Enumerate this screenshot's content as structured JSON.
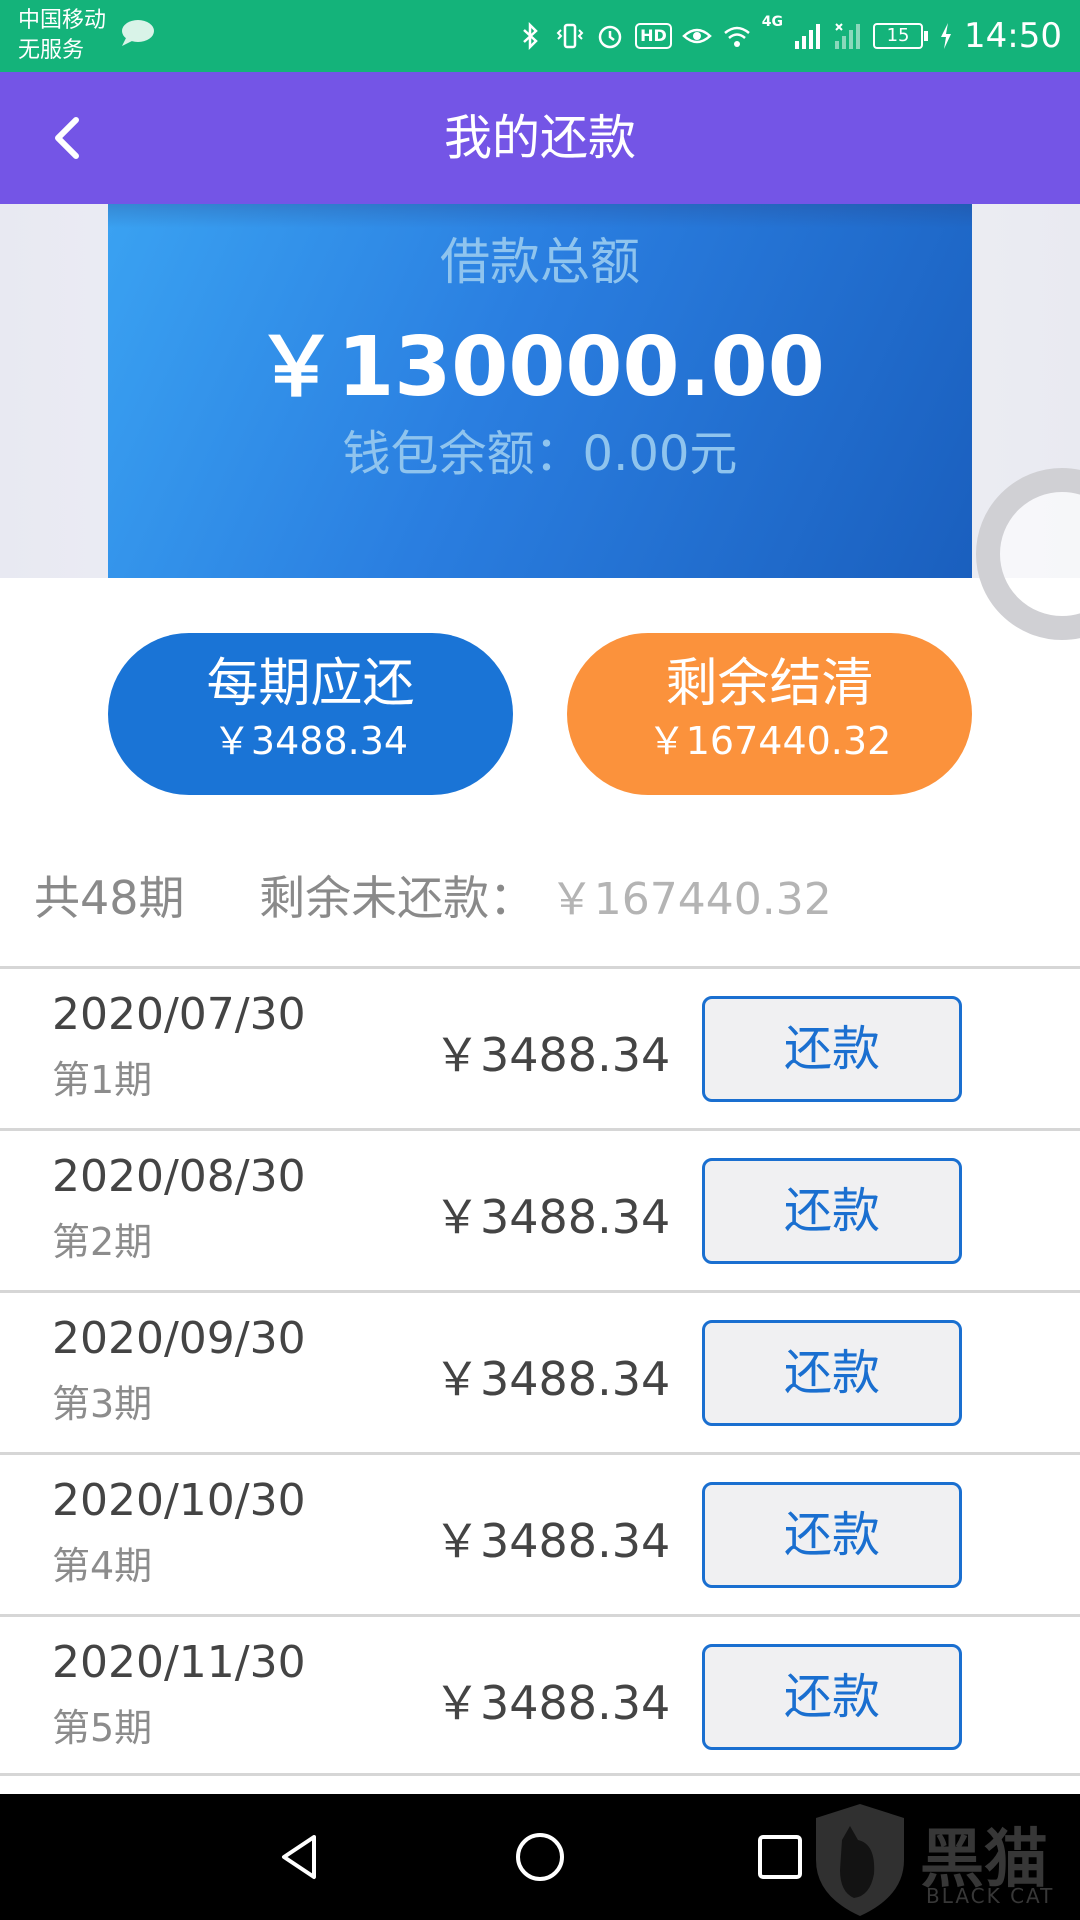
{
  "status_bar": {
    "carrier": "中国移动",
    "service": "无服务",
    "hd": "HD",
    "network": "4G",
    "battery": "15",
    "time": "14:50"
  },
  "header": {
    "title": "我的还款"
  },
  "loan_card": {
    "label": "借款总额",
    "amount": "￥130000.00",
    "wallet": "钱包余额：0.00元"
  },
  "summary": {
    "per_period_title": "每期应还",
    "per_period_value": "￥3488.34",
    "payoff_title": "剩余结清",
    "payoff_value": "￥167440.32"
  },
  "totals": {
    "periods": "共48期",
    "remaining_label": "剩余未还款：",
    "remaining_value": "￥167440.32"
  },
  "rows": [
    {
      "date": "2020/07/30",
      "period": "第1期",
      "amount": "￥3488.34",
      "button": "还款"
    },
    {
      "date": "2020/08/30",
      "period": "第2期",
      "amount": "￥3488.34",
      "button": "还款"
    },
    {
      "date": "2020/09/30",
      "period": "第3期",
      "amount": "￥3488.34",
      "button": "还款"
    },
    {
      "date": "2020/10/30",
      "period": "第4期",
      "amount": "￥3488.34",
      "button": "还款"
    },
    {
      "date": "2020/11/30",
      "period": "第5期",
      "amount": "￥3488.34",
      "button": "还款"
    }
  ],
  "watermark": {
    "text": "黑猫",
    "sub": "BLACK CAT"
  },
  "colors": {
    "status_bar": "#14b37a",
    "header": "#7455e6",
    "card_blue": "#2a7ee0",
    "pill_blue": "#1a74d6",
    "pill_orange": "#fb923c",
    "button_border": "#1a6fd0"
  },
  "icons": {
    "message": "message-bubble-icon",
    "bluetooth": "bluetooth-icon",
    "vibrate": "vibrate-icon",
    "alarm": "alarm-icon",
    "eye": "eye-comfort-icon",
    "wifi": "wifi-icon",
    "signal": "signal-icon",
    "back": "chevron-left-icon",
    "nav_back": "triangle-back-icon",
    "nav_home": "circle-home-icon",
    "nav_recent": "square-recent-icon"
  }
}
